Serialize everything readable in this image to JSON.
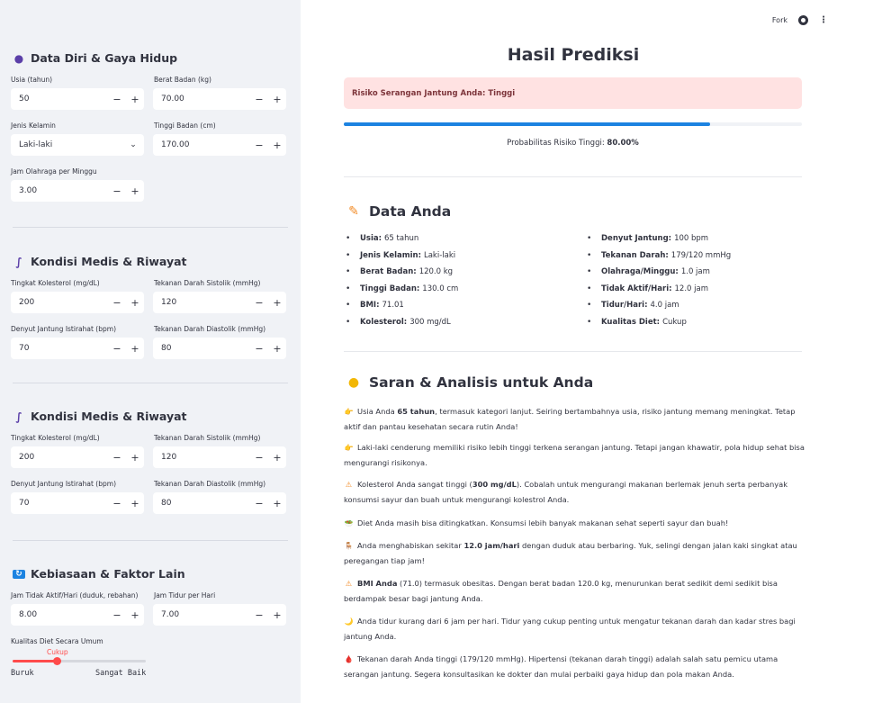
{
  "topbar": {
    "fork_label": "Fork"
  },
  "sidebar": {
    "section1": {
      "title": "Data Diri & Gaya Hidup",
      "age": {
        "label": "Usia (tahun)",
        "value": "50"
      },
      "weight": {
        "label": "Berat Badan (kg)",
        "value": "70.00"
      },
      "gender": {
        "label": "Jenis Kelamin",
        "value": "Laki-laki"
      },
      "height": {
        "label": "Tinggi Badan (cm)",
        "value": "170.00"
      },
      "exercise": {
        "label": "Jam Olahraga per Minggu",
        "value": "3.00"
      }
    },
    "section2": {
      "title": "Kondisi Medis & Riwayat",
      "chol": {
        "label": "Tingkat Kolesterol (mg/dL)",
        "value": "200"
      },
      "sys": {
        "label": "Tekanan Darah Sistolik (mmHg)",
        "value": "120"
      },
      "hr": {
        "label": "Denyut Jantung Istirahat (bpm)",
        "value": "70"
      },
      "dia": {
        "label": "Tekanan Darah Diastolik (mmHg)",
        "value": "80"
      }
    },
    "section3": {
      "title": "Kondisi Medis & Riwayat",
      "chol": {
        "label": "Tingkat Kolesterol (mg/dL)",
        "value": "200"
      },
      "sys": {
        "label": "Tekanan Darah Sistolik (mmHg)",
        "value": "120"
      },
      "hr": {
        "label": "Denyut Jantung Istirahat (bpm)",
        "value": "70"
      },
      "dia": {
        "label": "Tekanan Darah Diastolik (mmHg)",
        "value": "80"
      }
    },
    "section4": {
      "title": "Kebiasaan & Faktor Lain",
      "sedentary": {
        "label": "Jam Tidak Aktif/Hari (duduk, rebahan)",
        "value": "8.00"
      },
      "sleep": {
        "label": "Jam Tidur per Hari",
        "value": "7.00"
      },
      "diet": {
        "label": "Kualitas Diet Secara Umum",
        "value": "Cukup",
        "min_label": "Buruk",
        "max_label": "Sangat Baik",
        "position_fraction": 0.33
      }
    },
    "colors": {
      "accent": "#ff4b4b",
      "background": "#f0f2f6"
    }
  },
  "main": {
    "title": "Hasil Prediksi",
    "alert": "Risiko Serangan Jantung Anda: Tinggi",
    "progress": 0.8,
    "prob_label": "Probabilitas Risiko Tinggi:",
    "prob_value": "80.00%",
    "data_title": "Data Anda",
    "data_left": [
      {
        "k": "Usia:",
        "v": "65 tahun"
      },
      {
        "k": "Jenis Kelamin:",
        "v": "Laki-laki"
      },
      {
        "k": "Berat Badan:",
        "v": "120.0 kg"
      },
      {
        "k": "Tinggi Badan:",
        "v": "130.0 cm"
      },
      {
        "k": "BMI:",
        "v": "71.01"
      },
      {
        "k": "Kolesterol:",
        "v": "300 mg/dL"
      }
    ],
    "data_right": [
      {
        "k": "Denyut Jantung:",
        "v": "100 bpm"
      },
      {
        "k": "Tekanan Darah:",
        "v": "179/120 mmHg"
      },
      {
        "k": "Olahraga/Minggu:",
        "v": "1.0 jam"
      },
      {
        "k": "Tidak Aktif/Hari:",
        "v": "12.0 jam"
      },
      {
        "k": "Tidur/Hari:",
        "v": "4.0 jam"
      },
      {
        "k": "Kualitas Diet:",
        "v": "Cukup"
      }
    ],
    "advice_title": "Saran & Analisis untuk Anda",
    "advice": [
      {
        "icon": "👉",
        "pre": "Usia Anda ",
        "bold": "65 tahun",
        "post": ", termasuk kategori lanjut. Seiring bertambahnya usia, risiko jantung memang meningkat. Tetap aktif dan pantau kesehatan secara rutin Anda!"
      },
      {
        "icon": "👉",
        "pre": "Laki-laki cenderung memiliki risiko lebih tinggi terkena serangan jantung. Tetapi jangan khawatir, pola hidup sehat bisa mengurangi risikonya.",
        "bold": "",
        "post": ""
      },
      {
        "icon": "⚠",
        "pre": "Kolesterol Anda sangat tinggi (",
        "bold": "300 mg/dL",
        "post": "). Cobalah untuk mengurangi makanan berlemak jenuh serta perbanyak konsumsi sayur dan buah untuk mengurangi kolestrol Anda."
      },
      {
        "icon": "🥗",
        "pre": "Diet Anda masih bisa ditingkatkan. Konsumsi lebih banyak makanan sehat seperti sayur dan buah!",
        "bold": "",
        "post": ""
      },
      {
        "icon": "🪑",
        "pre": "Anda menghabiskan sekitar ",
        "bold": "12.0 jam/hari",
        "post": " dengan duduk atau berbaring. Yuk, selingi dengan jalan kaki singkat atau peregangan tiap jam!"
      },
      {
        "icon": "⚠",
        "pre": "",
        "bold": "BMI Anda",
        "post": " (71.0) termasuk obesitas. Dengan berat badan 120.0 kg, menurunkan berat sedikit demi sedikit bisa berdampak besar bagi jantung Anda."
      },
      {
        "icon": "🌙",
        "pre": "Anda tidur kurang dari 6 jam per hari. Tidur yang cukup penting untuk mengatur tekanan darah dan kadar stres bagi jantung Anda.",
        "bold": "",
        "post": ""
      },
      {
        "icon": "🩸",
        "pre": "Tekanan darah Anda tinggi (179/120 mmHg). Hipertensi (tekanan darah tinggi) adalah salah satu pemicu utama serangan jantung. Segera konsultasikan ke dokter dan mulai perbaiki gaya hidup dan pola makan Anda.",
        "bold": "",
        "post": ""
      }
    ]
  }
}
